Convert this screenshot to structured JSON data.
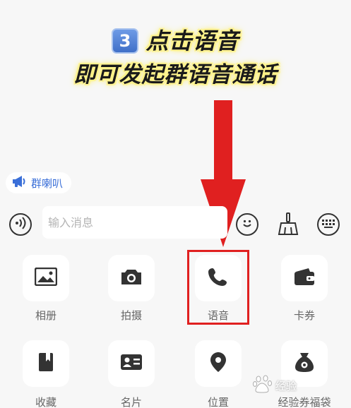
{
  "caption": {
    "step": "3",
    "line1": "点击语音",
    "line2": "即可发起群语音通话"
  },
  "horn": {
    "label": "群喇叭"
  },
  "input": {
    "placeholder": "输入消息"
  },
  "grid": [
    {
      "label": "相册",
      "icon": "photo-icon"
    },
    {
      "label": "拍摄",
      "icon": "camera-icon"
    },
    {
      "label": "语音",
      "icon": "phone-icon"
    },
    {
      "label": "卡券",
      "icon": "wallet-icon"
    },
    {
      "label": "收藏",
      "icon": "bookmark-icon"
    },
    {
      "label": "名片",
      "icon": "contact-card-icon"
    },
    {
      "label": "位置",
      "icon": "location-pin-icon"
    },
    {
      "label": "经验券福袋",
      "icon": "money-bag-icon"
    }
  ],
  "watermark": {
    "text": "经验"
  },
  "colors": {
    "highlight": "#e02020",
    "horn_text": "#3a6fd8",
    "caption_glow": "#ffe94f"
  }
}
